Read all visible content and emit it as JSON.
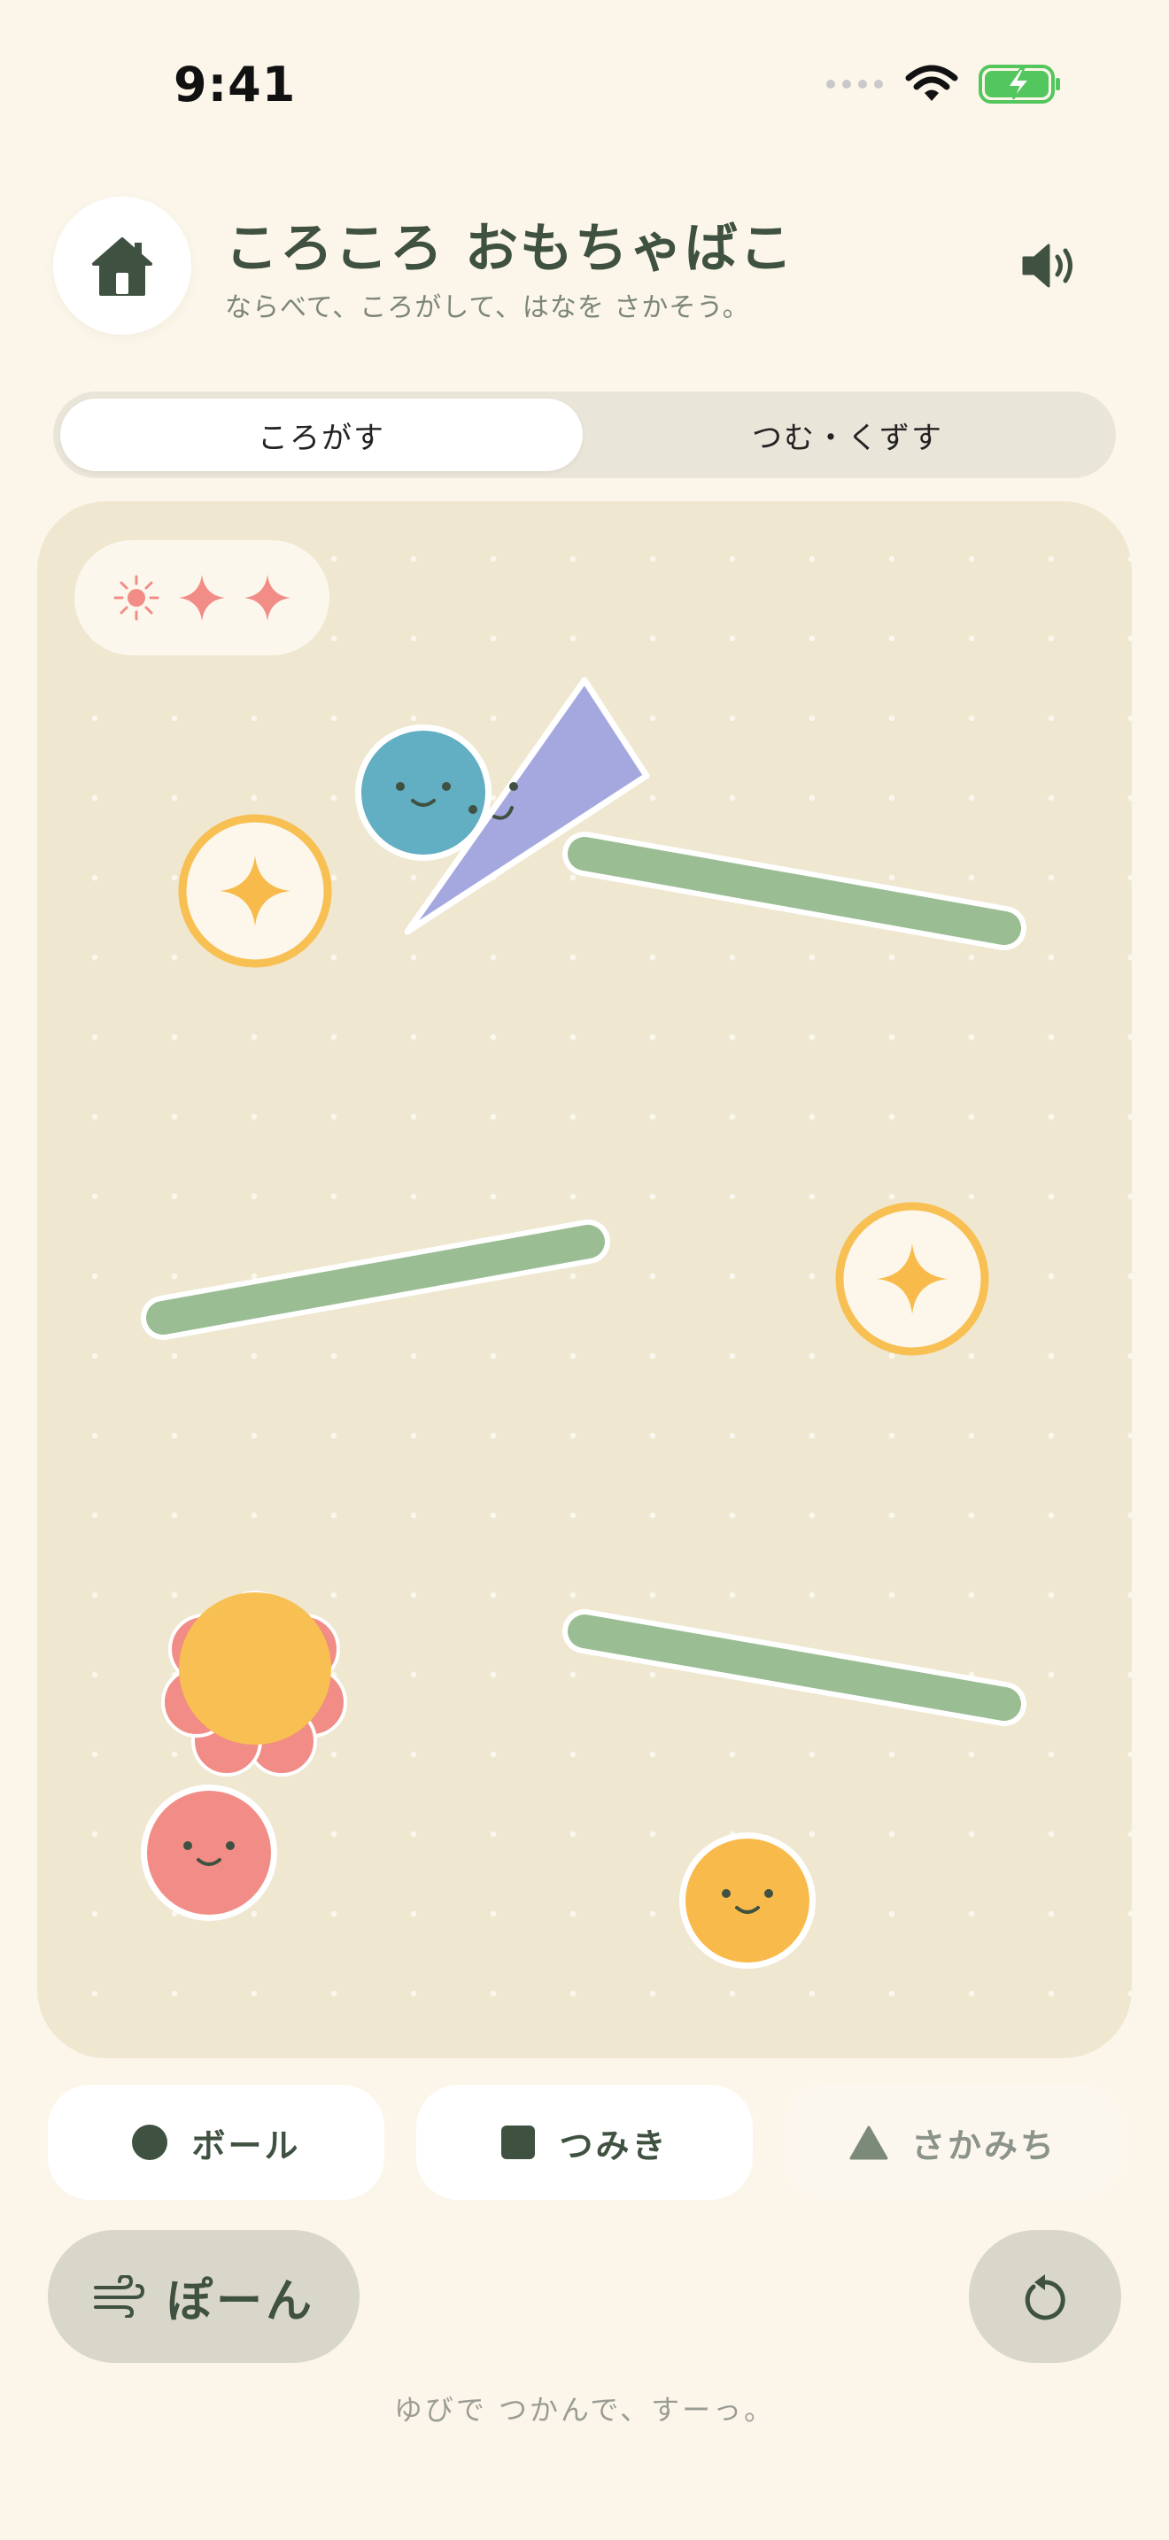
{
  "status": {
    "time": "9:41"
  },
  "header": {
    "title": "ころころ おもちゃばこ",
    "subtitle": "ならべて、ころがして、はなを さかそう。"
  },
  "modes": {
    "tabs": [
      {
        "label": "ころがす",
        "selected": true
      },
      {
        "label": "つむ・くずす",
        "selected": false
      }
    ]
  },
  "goals": {
    "icons": [
      "sun-icon",
      "sparkle-icon",
      "sparkle-icon"
    ],
    "color": "#F28C86"
  },
  "tools": [
    {
      "label": "ボール",
      "icon": "ball-icon"
    },
    {
      "label": "つみき",
      "icon": "block-icon"
    },
    {
      "label": "さかみち",
      "icon": "slope-icon"
    }
  ],
  "actions": {
    "blow_label": "ぽーん",
    "blow_icon": "wind-icon",
    "reset_icon": "reset-icon"
  },
  "hint": "ゆびで つかんで、すーっ。",
  "colors": {
    "background": "#FCF6EA",
    "play_area": "#EFE7D0",
    "text": "#3F5140",
    "ball_blue": "#62AEC3",
    "ball_pink": "#F28C86",
    "ball_yellow": "#F8BB4B",
    "ramp_green": "#9ABD93",
    "triangle_purple": "#A5A8DE",
    "target_ring": "#F8BF52"
  }
}
